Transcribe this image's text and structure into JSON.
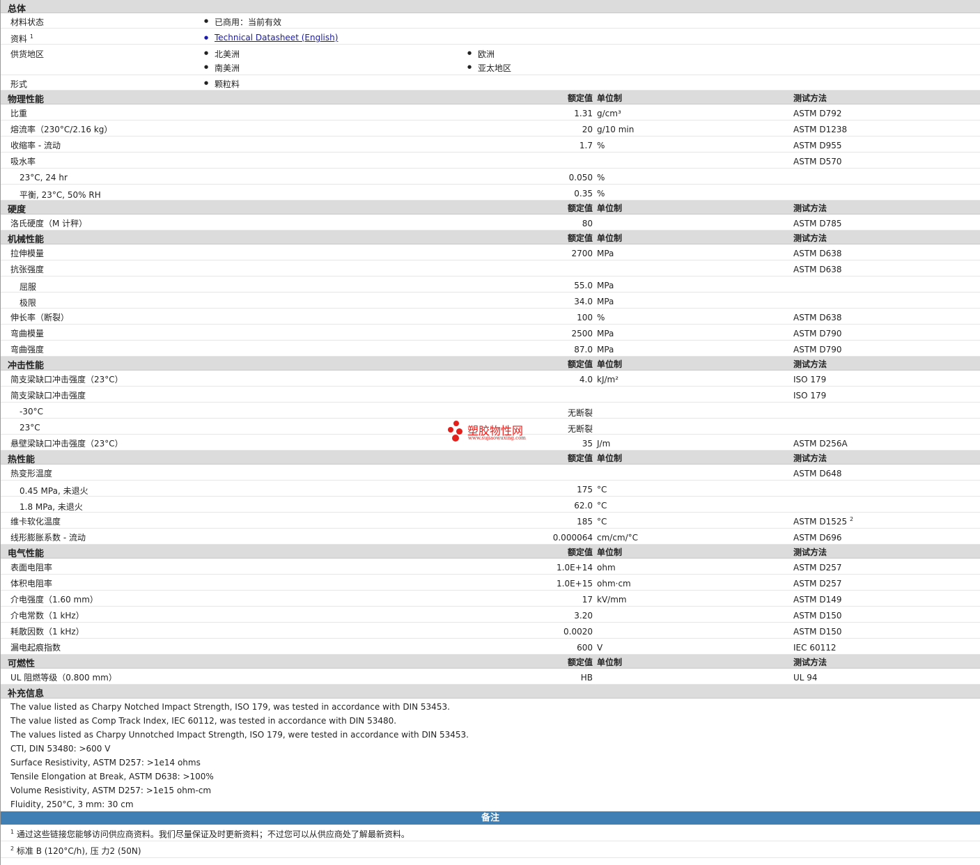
{
  "general": {
    "header": "总体",
    "status_label": "材料状态",
    "status_value": "已商用：当前有效",
    "docs_label": "资料",
    "docs_sup": "1",
    "docs_link": "Technical Datasheet (English)",
    "region_label": "供货地区",
    "regions": [
      "北美洲",
      "欧洲",
      "南美洲",
      "亚太地区"
    ],
    "form_label": "形式",
    "form_value": "颗粒料"
  },
  "column_headers": {
    "value": "额定值",
    "unit": "单位制",
    "method": "测试方法"
  },
  "sections": [
    {
      "title": "物理性能",
      "rows": [
        {
          "label": "比重",
          "value": "1.31",
          "unit": "g/cm³",
          "method": "ASTM D792"
        },
        {
          "label": "熔流率（230°C/2.16 kg）",
          "value": "20",
          "unit": "g/10 min",
          "method": "ASTM D1238"
        },
        {
          "label": "收缩率 - 流动",
          "value": "1.7",
          "unit": "%",
          "method": "ASTM D955"
        },
        {
          "label": "吸水率",
          "value": "",
          "unit": "",
          "method": "ASTM D570"
        },
        {
          "label": "23°C, 24 hr",
          "value": "0.050",
          "unit": "%",
          "method": "",
          "sub": true
        },
        {
          "label": "平衡, 23°C, 50% RH",
          "value": "0.35",
          "unit": "%",
          "method": "",
          "sub": true
        }
      ]
    },
    {
      "title": "硬度",
      "rows": [
        {
          "label": "洛氏硬度（M 计秤）",
          "value": "80",
          "unit": "",
          "method": "ASTM D785"
        }
      ]
    },
    {
      "title": "机械性能",
      "rows": [
        {
          "label": "拉伸模量",
          "value": "2700",
          "unit": "MPa",
          "method": "ASTM D638"
        },
        {
          "label": "抗张强度",
          "value": "",
          "unit": "",
          "method": "ASTM D638"
        },
        {
          "label": "屈服",
          "value": "55.0",
          "unit": "MPa",
          "method": "",
          "sub": true
        },
        {
          "label": "极限",
          "value": "34.0",
          "unit": "MPa",
          "method": "",
          "sub": true
        },
        {
          "label": "伸长率（断裂）",
          "value": "100",
          "unit": "%",
          "method": "ASTM D638"
        },
        {
          "label": "弯曲模量",
          "value": "2500",
          "unit": "MPa",
          "method": "ASTM D790"
        },
        {
          "label": "弯曲强度",
          "value": "87.0",
          "unit": "MPa",
          "method": "ASTM D790"
        }
      ]
    },
    {
      "title": "冲击性能",
      "rows": [
        {
          "label": "简支梁缺口冲击强度（23°C）",
          "value": "4.0",
          "unit": "kJ/m²",
          "method": "ISO 179"
        },
        {
          "label": "简支梁缺口冲击强度",
          "value": "",
          "unit": "",
          "method": "ISO 179"
        },
        {
          "label": "-30°C",
          "value": "无断裂",
          "unit": "",
          "method": "",
          "sub": true
        },
        {
          "label": "23°C",
          "value": "无断裂",
          "unit": "",
          "method": "",
          "sub": true
        },
        {
          "label": "悬壁梁缺口冲击强度（23°C）",
          "value": "35",
          "unit": "J/m",
          "method": "ASTM D256A"
        }
      ]
    },
    {
      "title": "热性能",
      "rows": [
        {
          "label": "热变形温度",
          "value": "",
          "unit": "",
          "method": "ASTM D648"
        },
        {
          "label": "0.45 MPa, 未退火",
          "value": "175",
          "unit": "°C",
          "method": "",
          "sub": true
        },
        {
          "label": "1.8 MPa, 未退火",
          "value": "62.0",
          "unit": "°C",
          "method": "",
          "sub": true
        },
        {
          "label": "维卡软化温度",
          "value": "185",
          "unit": "°C",
          "method": "ASTM D1525",
          "method_sup": "2"
        },
        {
          "label": "线形膨胀系数 - 流动",
          "value": "0.000064",
          "unit": "cm/cm/°C",
          "method": "ASTM D696"
        }
      ]
    },
    {
      "title": "电气性能",
      "rows": [
        {
          "label": "表面电阻率",
          "value": "1.0E+14",
          "unit": "ohm",
          "method": "ASTM D257"
        },
        {
          "label": "体积电阻率",
          "value": "1.0E+15",
          "unit": "ohm·cm",
          "method": "ASTM D257"
        },
        {
          "label": "介电强度（1.60 mm）",
          "value": "17",
          "unit": "kV/mm",
          "method": "ASTM D149"
        },
        {
          "label": "介电常数（1 kHz）",
          "value": "3.20",
          "unit": "",
          "method": "ASTM D150"
        },
        {
          "label": "耗散因数（1 kHz）",
          "value": "0.0020",
          "unit": "",
          "method": "ASTM D150"
        },
        {
          "label": "漏电起痕指数",
          "value": "600",
          "unit": "V",
          "method": "IEC 60112"
        }
      ]
    },
    {
      "title": "可燃性",
      "rows": [
        {
          "label": "UL 阻燃等级（0.800 mm）",
          "value": "HB",
          "unit": "",
          "method": "UL 94"
        }
      ]
    }
  ],
  "supplement": {
    "title": "补充信息",
    "lines": [
      "The value listed as Charpy Notched Impact Strength, ISO 179, was tested in accordance with DIN 53453.",
      "The value listed as Comp Track Index, IEC 60112, was tested in accordance with DIN 53480.",
      "The values listed as Charpy Unnotched Impact Strength, ISO 179, were tested in accordance with DIN 53453.",
      "CTI, DIN 53480: >600 V",
      "Surface Resistivity, ASTM D257: >1e14 ohms",
      "Tensile Elongation at Break, ASTM D638: >100%",
      "Volume Resistivity, ASTM D257: >1e15 ohm-cm",
      "Fluidity, 250°C, 3 mm: 30 cm"
    ]
  },
  "notes": {
    "title": "备注",
    "items": [
      {
        "num": "1",
        "text": "通过这些链接您能够访问供应商资料。我们尽量保证及时更新资料；不过您可以从供应商处了解最新资料。"
      },
      {
        "num": "2",
        "text": "标准 B (120°C/h), 压 力2 (50N)"
      }
    ]
  },
  "watermark": {
    "cn": "塑胶物性网",
    "en": "www.sujiaowuxing.com"
  },
  "colors": {
    "section_bg": "#dcdcdc",
    "notes_bar": "#3f7fb3",
    "link": "#1a1aa6",
    "logo": "#e4201c"
  }
}
